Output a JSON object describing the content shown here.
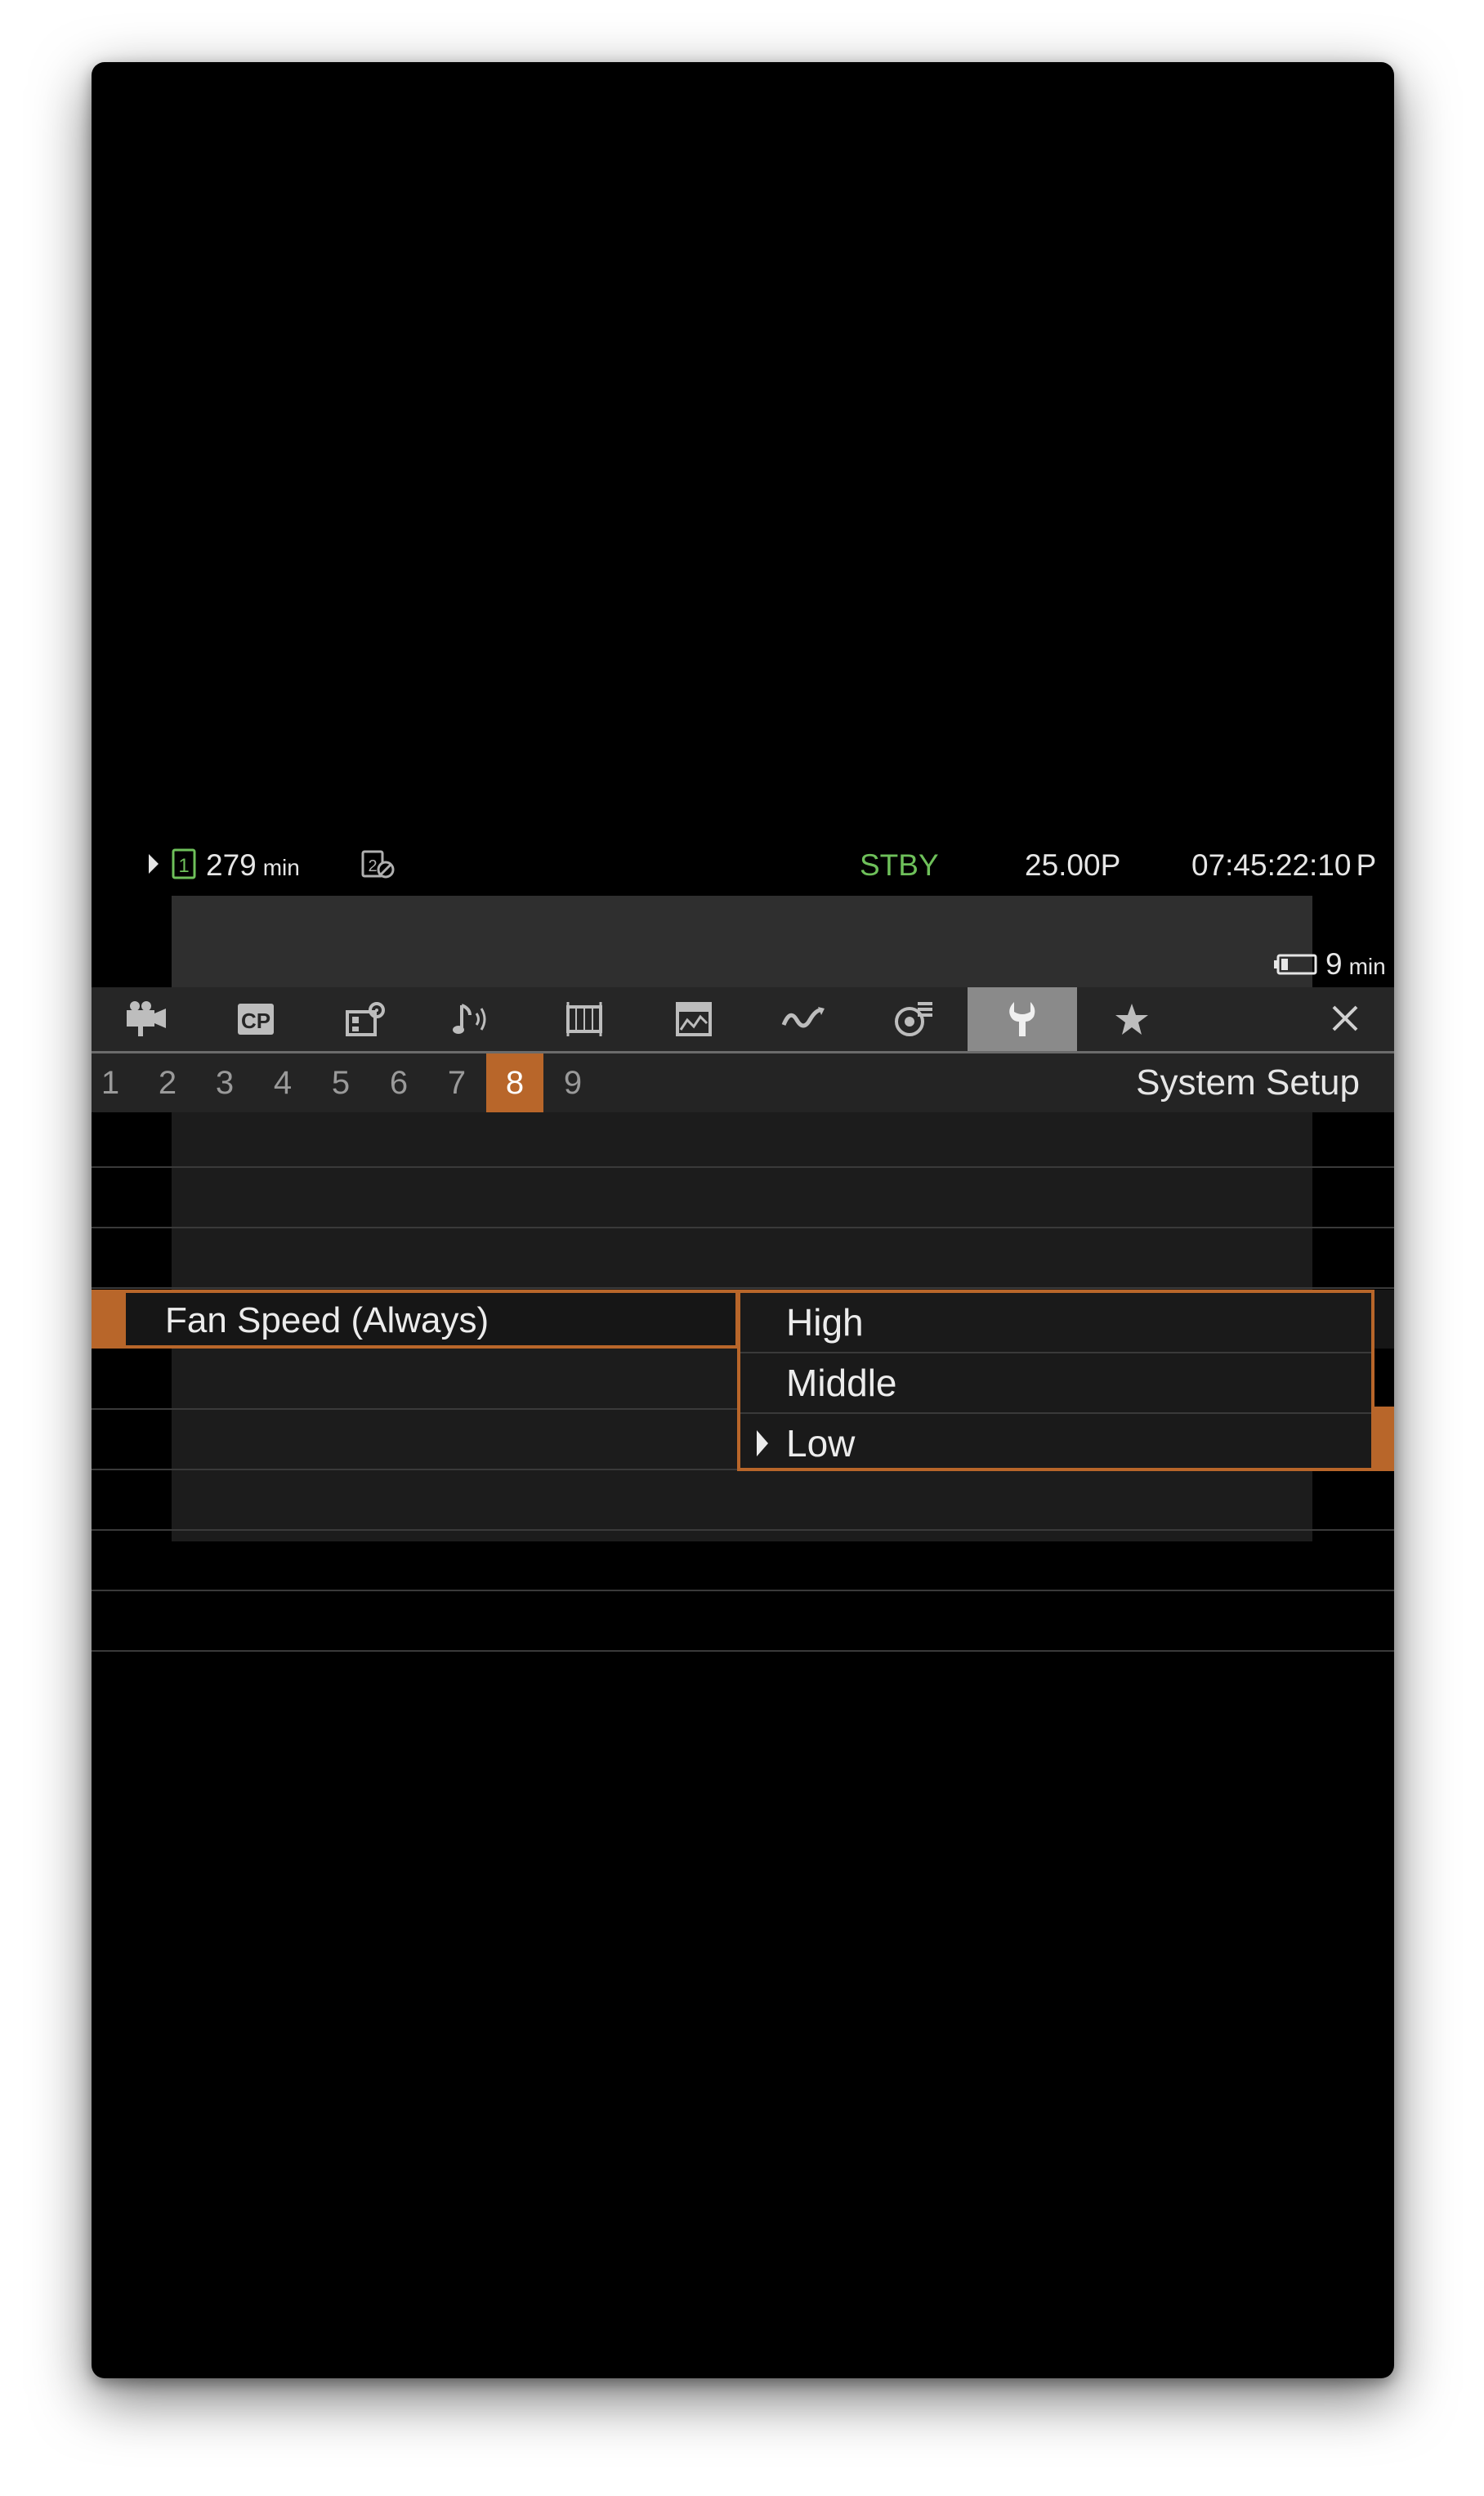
{
  "status": {
    "media_remaining_value": "279",
    "media_remaining_unit": "min",
    "state": "STBY",
    "frame_rate": "25.00P",
    "timecode": "07:45:22:10",
    "timecode_suffix": "P",
    "battery_value": "9",
    "battery_unit": "min"
  },
  "tabs": [
    {
      "id": "camera",
      "icon": "camera-icon"
    },
    {
      "id": "cp",
      "icon": "cp-icon",
      "label": "CP"
    },
    {
      "id": "recording-media",
      "icon": "recording-setup-icon"
    },
    {
      "id": "audio",
      "icon": "audio-icon"
    },
    {
      "id": "video",
      "icon": "video-setup-icon"
    },
    {
      "id": "assist",
      "icon": "assist-function-icon"
    },
    {
      "id": "wave",
      "icon": "waveform-icon"
    },
    {
      "id": "network",
      "icon": "network-icon"
    },
    {
      "id": "system",
      "icon": "wrench-icon",
      "active": true
    },
    {
      "id": "my-menu",
      "icon": "star-icon"
    }
  ],
  "pages": [
    "1",
    "2",
    "3",
    "4",
    "5",
    "6",
    "7",
    "8",
    "9"
  ],
  "active_page": "8",
  "menu_title": "System Setup",
  "selected_item": {
    "label": "Fan Speed (Always)"
  },
  "options": [
    {
      "label": "High"
    },
    {
      "label": "Middle"
    },
    {
      "label": "Low",
      "current": true
    }
  ],
  "colors": {
    "accent": "#b8662a",
    "stby": "#6ec05a",
    "active_tab": "#8a8a8a"
  }
}
